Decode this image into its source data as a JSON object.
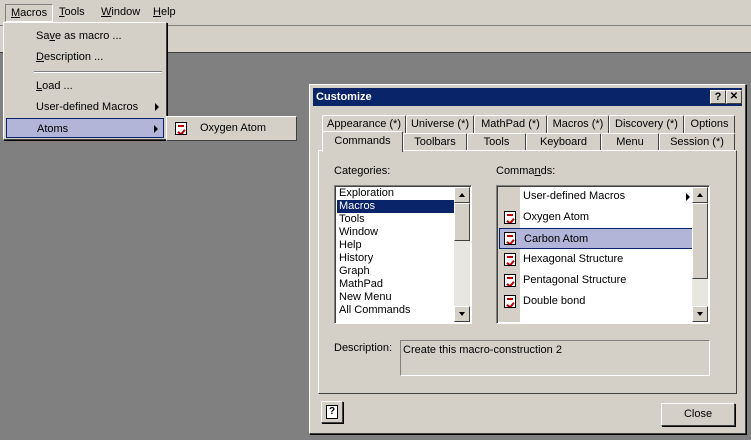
{
  "menubar": {
    "items": [
      {
        "label": "Macros",
        "accel": "M",
        "rest": "acros"
      },
      {
        "label": "Tools",
        "accel": "T",
        "rest": "ools"
      },
      {
        "label": "Window",
        "accel": "W",
        "rest": "indow"
      },
      {
        "label": "Help",
        "accel": "H",
        "rest": "elp"
      }
    ]
  },
  "macros_menu": {
    "items": [
      {
        "pre": "Sa",
        "accel": "v",
        "post": "e as macro ..."
      },
      {
        "pre": "",
        "accel": "D",
        "post": "escription ..."
      },
      {
        "pre": "",
        "accel": "L",
        "post": "oad ..."
      },
      {
        "pre": "User-defined Macros",
        "accel": "",
        "post": ""
      },
      {
        "pre": "Atoms",
        "accel": "",
        "post": ""
      }
    ],
    "submenu": {
      "item": "Oxygen Atom",
      "icon": "macro-icon"
    }
  },
  "dialog": {
    "title": "Customize",
    "help_button": "?",
    "close_button": "✕",
    "tabs_back": [
      "Appearance (*)",
      "Universe (*)",
      "MathPad (*)",
      "Macros (*)",
      "Discovery (*)",
      "Options"
    ],
    "tabs_front": [
      "Commands",
      "Toolbars",
      "Tools",
      "Keyboard",
      "Menu",
      "Session (*)"
    ],
    "active_tab": "Commands",
    "categories_label": "Categories:",
    "categories": [
      "Exploration",
      "Macros",
      "Tools",
      "Window",
      "Help",
      "History",
      "Graph",
      "MathPad",
      "New Menu",
      "All Commands"
    ],
    "selected_category": "Macros",
    "commands_label_pre": "Comma",
    "commands_label_accel": "n",
    "commands_label_post": "ds:",
    "commands": [
      "User-defined Macros",
      "Oxygen Atom",
      "Carbon Atom",
      "Hexagonal Structure",
      "Pentagonal Structure",
      "Double bond"
    ],
    "selected_command": "Carbon Atom",
    "description_label": "Description:",
    "description_value": "Create this macro-construction 2",
    "help_icon_button": "?",
    "close_label": "Close"
  },
  "colors": {
    "titlebar": "#0a246a",
    "highlight": "#b2b4d8",
    "desktop": "#808080",
    "face": "#d4d0c8"
  }
}
